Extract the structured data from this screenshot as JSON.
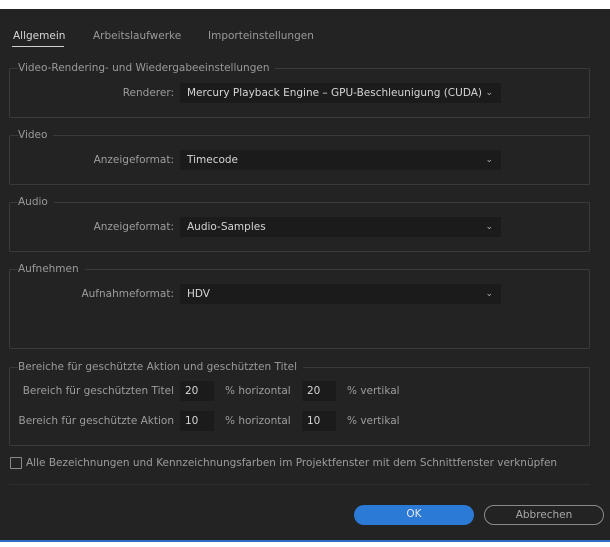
{
  "tabs": [
    {
      "label": "Allgemein",
      "active": true
    },
    {
      "label": "Arbeitslaufwerke",
      "active": false
    },
    {
      "label": "Importeinstellungen",
      "active": false
    }
  ],
  "rendering": {
    "legend": "Video-Rendering- und Wiedergabeeinstellungen",
    "label": "Renderer:",
    "value": "Mercury Playback Engine – GPU-Beschleunigung (CUDA)"
  },
  "video": {
    "legend": "Video",
    "label": "Anzeigeformat:",
    "value": "Timecode"
  },
  "audio": {
    "legend": "Audio",
    "label": "Anzeigeformat:",
    "value": "Audio-Samples"
  },
  "capture": {
    "legend": "Aufnehmen",
    "label": "Aufnahmeformat:",
    "value": "HDV"
  },
  "safe_areas": {
    "legend": "Bereiche für geschützte Aktion und geschützten Titel",
    "title_label": "Bereich für geschützten Titel",
    "title_h": "20",
    "title_v": "20",
    "action_label": "Bereich für geschützte Aktion",
    "action_h": "10",
    "action_v": "10",
    "unit_h": "% horizontal",
    "unit_v": "% vertikal"
  },
  "link_checkbox": {
    "label": "Alle Bezeichnungen und Kennzeichnungsfarben im Projektfenster mit dem Schnittfenster verknüpfen",
    "checked": false
  },
  "buttons": {
    "ok": "OK",
    "cancel": "Abbrechen"
  },
  "icons": {
    "dropdown": "chevron-down-icon"
  },
  "colors": {
    "accent": "#2b7ad6",
    "background": "#232323"
  }
}
